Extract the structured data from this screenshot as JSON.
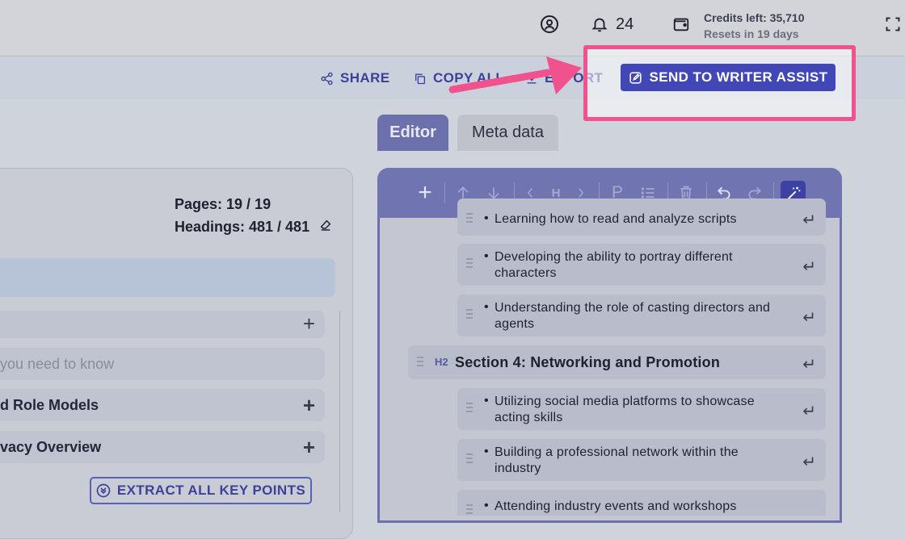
{
  "topbar": {
    "notification_count": "24",
    "credits_label": "Credits left: 35,710",
    "credits_reset": "Resets in 19 days",
    "icons": [
      "user-circle-icon",
      "bell-icon",
      "wallet-icon",
      "fullscreen-icon"
    ]
  },
  "actions": {
    "share": "SHARE",
    "copy_all": "COPY ALL",
    "export": "EXPORT",
    "send": "SEND TO WRITER ASSIST"
  },
  "tabs": {
    "editor": "Editor",
    "meta": "Meta data"
  },
  "stats": {
    "pages": "Pages: 19 / 19",
    "headings": "Headings: 481 / 481"
  },
  "left": {
    "row1": "",
    "row2": "you need to know",
    "row3": "d Role Models",
    "row4": "vacy Overview",
    "extract": "EXTRACT ALL KEY POINTS"
  },
  "editor": {
    "toolbar": {
      "h_label": "H",
      "p_label": "P"
    },
    "items": [
      {
        "type": "bullet",
        "lines": [
          "Learning how to read and analyze scripts"
        ]
      },
      {
        "type": "bullet",
        "lines": [
          "Developing the ability to portray different",
          "characters"
        ]
      },
      {
        "type": "bullet",
        "lines": [
          "Understanding the role of casting directors and",
          "agents"
        ]
      },
      {
        "type": "h2",
        "tag": "H2",
        "lines": [
          "Section 4: Networking and Promotion"
        ]
      },
      {
        "type": "bullet",
        "lines": [
          "Utilizing social media platforms to showcase",
          "acting skills"
        ]
      },
      {
        "type": "bullet",
        "lines": [
          "Building a professional network within the",
          "industry"
        ]
      },
      {
        "type": "bullet",
        "lines": [
          "Attending industry events and workshops"
        ]
      }
    ]
  },
  "colors": {
    "accent": "#4147b7",
    "highlight": "#f0528d",
    "toolbar": "#7074b1"
  }
}
